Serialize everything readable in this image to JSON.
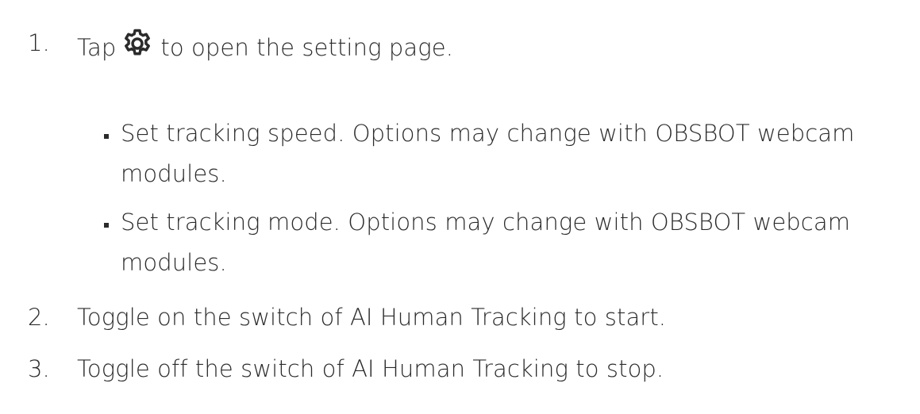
{
  "steps": [
    {
      "number": "1.",
      "text_before_icon": "Tap",
      "icon": "gear-icon",
      "text_after_icon": "to open the setting page.",
      "bullets": [
        {
          "line1": "Set tracking speed. Options may change with OBSBOT webcam",
          "line2": "modules."
        },
        {
          "line1": "Set tracking mode. Options may change with OBSBOT webcam",
          "line2": "modules."
        }
      ]
    },
    {
      "number": "2.",
      "text": "Toggle on the switch of AI Human Tracking to start."
    },
    {
      "number": "3.",
      "text": "Toggle off the switch of AI Human Tracking to stop."
    }
  ],
  "colors": {
    "text": "#2b2b2b",
    "background": "#ffffff"
  }
}
